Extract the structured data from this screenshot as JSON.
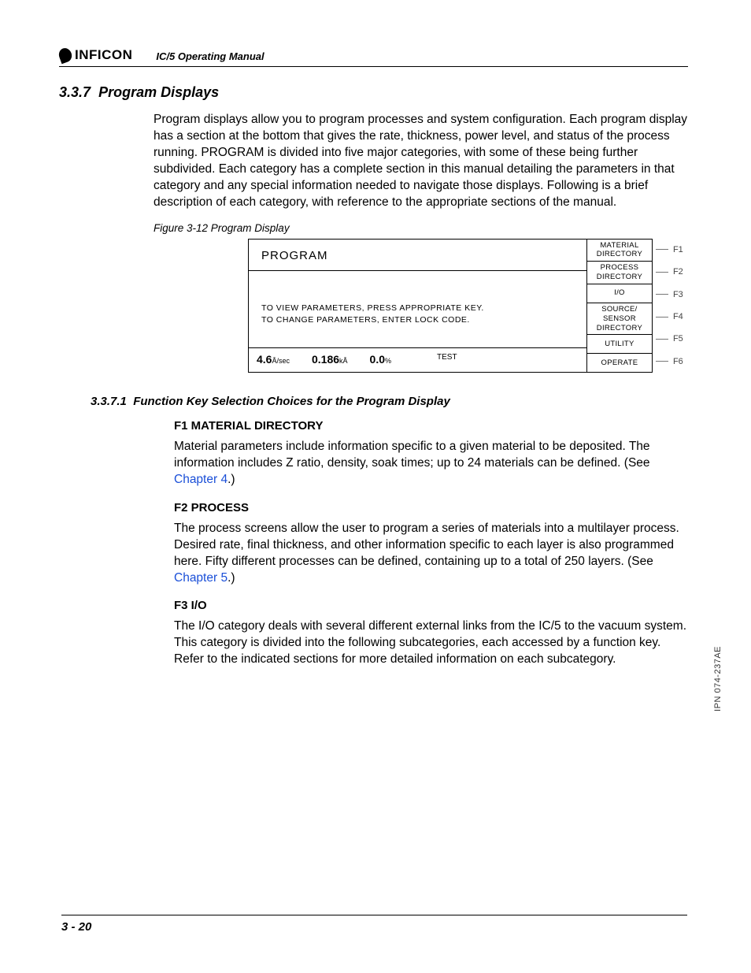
{
  "header": {
    "brand": "INFICON",
    "doc_title": "IC/5 Operating Manual"
  },
  "section": {
    "number": "3.3.7",
    "title": "Program Displays",
    "intro": "Program displays allow you to program processes and system configuration. Each program display has a section at the bottom that gives the rate, thickness, power level, and status of the process running. PROGRAM is divided into five major categories, with some of these being further subdivided. Each category has a complete section in this manual detailing the parameters in that category and any special information needed to navigate those displays. Following is a brief description of each category, with reference to the appropriate sections of the manual."
  },
  "figure": {
    "caption": "Figure 3-12  Program Display",
    "screen_title": "PROGRAM",
    "instruction_line1": "TO VIEW PARAMETERS, PRESS APPROPRIATE KEY.",
    "instruction_line2": "TO CHANGE PARAMETERS, ENTER LOCK CODE.",
    "status": {
      "rate_value": "4.6",
      "rate_unit": "Å/sec",
      "thickness_value": "0.186",
      "thickness_unit": "kÅ",
      "power_value": "0.0",
      "power_unit": "%",
      "mode": "TEST"
    },
    "fkeys": [
      {
        "label": "MATERIAL DIRECTORY",
        "tag": "F1"
      },
      {
        "label": "PROCESS DIRECTORY",
        "tag": "F2"
      },
      {
        "label": "I/O",
        "tag": "F3"
      },
      {
        "label": "SOURCE/ SENSOR DIRECTORY",
        "tag": "F4"
      },
      {
        "label": "UTILITY",
        "tag": "F5"
      },
      {
        "label": "OPERATE",
        "tag": "F6"
      }
    ]
  },
  "subsection": {
    "number": "3.3.7.1",
    "title": "Function Key Selection Choices for the Program Display"
  },
  "functions": {
    "f1": {
      "heading": "F1  MATERIAL DIRECTORY",
      "body_prefix": "Material parameters include information specific to a given material to be deposited. The information includes Z ratio, density, soak times; up to 24 materials can be defined. (See ",
      "link": "Chapter 4",
      "body_suffix": ".)"
    },
    "f2": {
      "heading": "F2  PROCESS",
      "body_prefix": "The process screens allow the user to program a series of materials into a multilayer process. Desired rate, final thickness, and other information specific to each layer is also programmed here. Fifty different processes can be defined, containing up to a total of 250 layers. (See ",
      "link": "Chapter 5",
      "body_suffix": ".)"
    },
    "f3": {
      "heading": "F3  I/O",
      "body": "The I/O category deals with several different external links from the IC/5 to the vacuum system. This category is divided into the following subcategories, each accessed by a function key. Refer to the indicated sections for more detailed information on each subcategory."
    }
  },
  "page_number": "3 - 20",
  "side_label": "IPN 074-237AE"
}
